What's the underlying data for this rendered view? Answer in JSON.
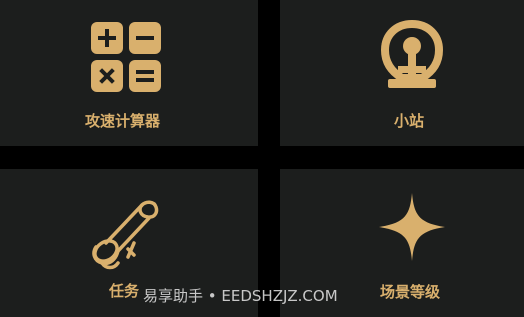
{
  "tiles": [
    {
      "label": "攻速计算器",
      "icon": "calculator-icon"
    },
    {
      "label": "小站",
      "icon": "train-station-icon"
    },
    {
      "label": "任务",
      "icon": "scroll-icon"
    },
    {
      "label": "场景等级",
      "icon": "four-point-star-icon"
    }
  ],
  "watermark": "易享助手 • EEDSHZJZ.COM",
  "colors": {
    "accent": "#d9b06d",
    "tile_bg": "#1c1e1d",
    "background": "#000000"
  }
}
